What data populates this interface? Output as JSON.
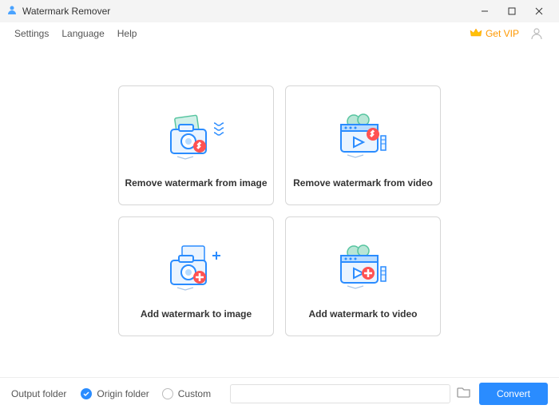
{
  "titlebar": {
    "title": "Watermark Remover"
  },
  "menubar": {
    "settings": "Settings",
    "language": "Language",
    "help": "Help",
    "get_vip": "Get VIP"
  },
  "cards": {
    "remove_image": "Remove watermark from image",
    "remove_video": "Remove watermark from video",
    "add_image": "Add watermark to image",
    "add_video": "Add watermark to video"
  },
  "footer": {
    "output_label": "Output folder",
    "origin_folder": "Origin folder",
    "custom": "Custom",
    "path_value": "",
    "convert": "Convert"
  },
  "colors": {
    "accent": "#2a8cff",
    "vip": "#ff9800"
  }
}
